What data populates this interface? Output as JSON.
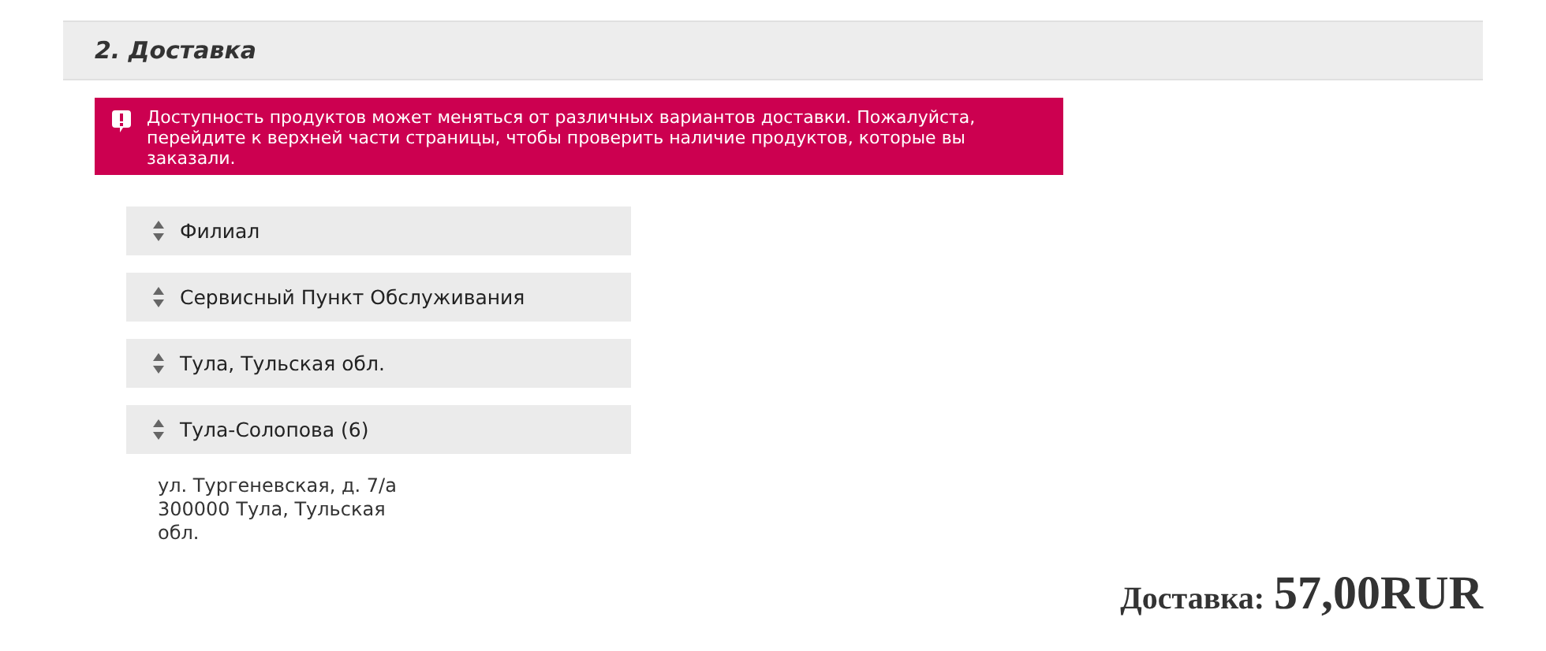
{
  "section": {
    "title": "2. Доставка"
  },
  "alert": {
    "text": "Доступность продуктов может меняться от различных вариантов доставки. Пожалуйста, перейдите к верхней части страницы, чтобы проверить наличие продуктов, которые вы заказали."
  },
  "options": [
    {
      "label": "Филиал"
    },
    {
      "label": "Сервисный Пункт Обслуживания"
    },
    {
      "label": "Тула, Тульская обл."
    },
    {
      "label": "Тула-Солопова (6)"
    }
  ],
  "address": [
    "ул. Тургеневская, д. 7/а",
    "300000 Тула, Тульская обл."
  ],
  "total": {
    "label": "Доставка:",
    "value": "57,00RUR"
  }
}
